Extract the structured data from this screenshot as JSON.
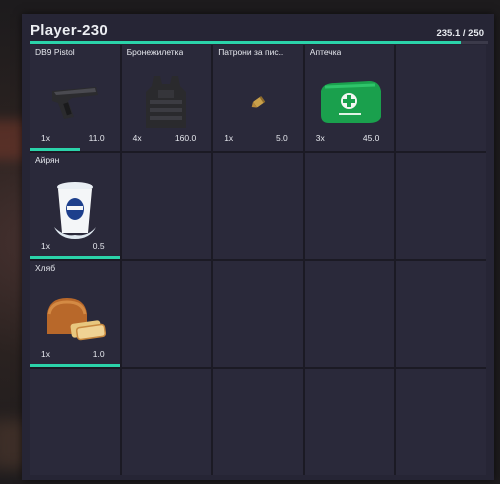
{
  "header": {
    "player_name": "Player-230",
    "weight_text": "235.1 / 250",
    "weight_fraction": 0.94
  },
  "colors": {
    "accent": "#2bd3aa",
    "panel": "#262535",
    "cell": "#2a293a"
  },
  "items": [
    {
      "name": "DB9 Pistol",
      "qty": "1x",
      "weight": "11.0",
      "icon": "pistol-icon",
      "condition": 0.56
    },
    {
      "name": "Бронежилетка",
      "qty": "4x",
      "weight": "160.0",
      "icon": "body-armor-icon",
      "condition": 0
    },
    {
      "name": "Патрони за пис..",
      "qty": "1x",
      "weight": "5.0",
      "icon": "bullet-icon",
      "condition": 0
    },
    {
      "name": "Аптечка",
      "qty": "3x",
      "weight": "45.0",
      "icon": "medkit-icon",
      "condition": 0
    },
    {
      "name": "Айрян",
      "qty": "1x",
      "weight": "0.5",
      "icon": "ayran-cup-icon",
      "condition": 1
    },
    {
      "name": "Хляб",
      "qty": "1x",
      "weight": "1.0",
      "icon": "bread-icon",
      "condition": 1
    }
  ]
}
